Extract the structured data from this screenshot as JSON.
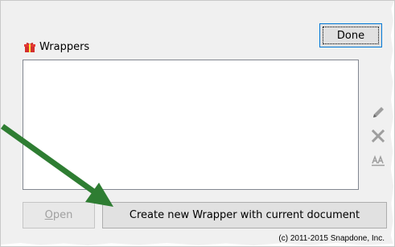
{
  "done_label": "Done",
  "group": {
    "label": "Wrappers"
  },
  "list": {
    "items": []
  },
  "buttons": {
    "open_label_prefix": "",
    "open_label_mnemonic": "O",
    "open_label_rest": "pen",
    "create_label": "Create new Wrapper with current document"
  },
  "copyright": "(c) 2011-2015 Snapdone, Inc.",
  "colors": {
    "arrow": "#2e7d32",
    "gift": "#d32f2f",
    "focus_border": "#0078d7"
  },
  "icons": {
    "edit": "pencil-icon",
    "delete": "x-icon",
    "rename": "rename-icon",
    "group": "gift-icon"
  }
}
